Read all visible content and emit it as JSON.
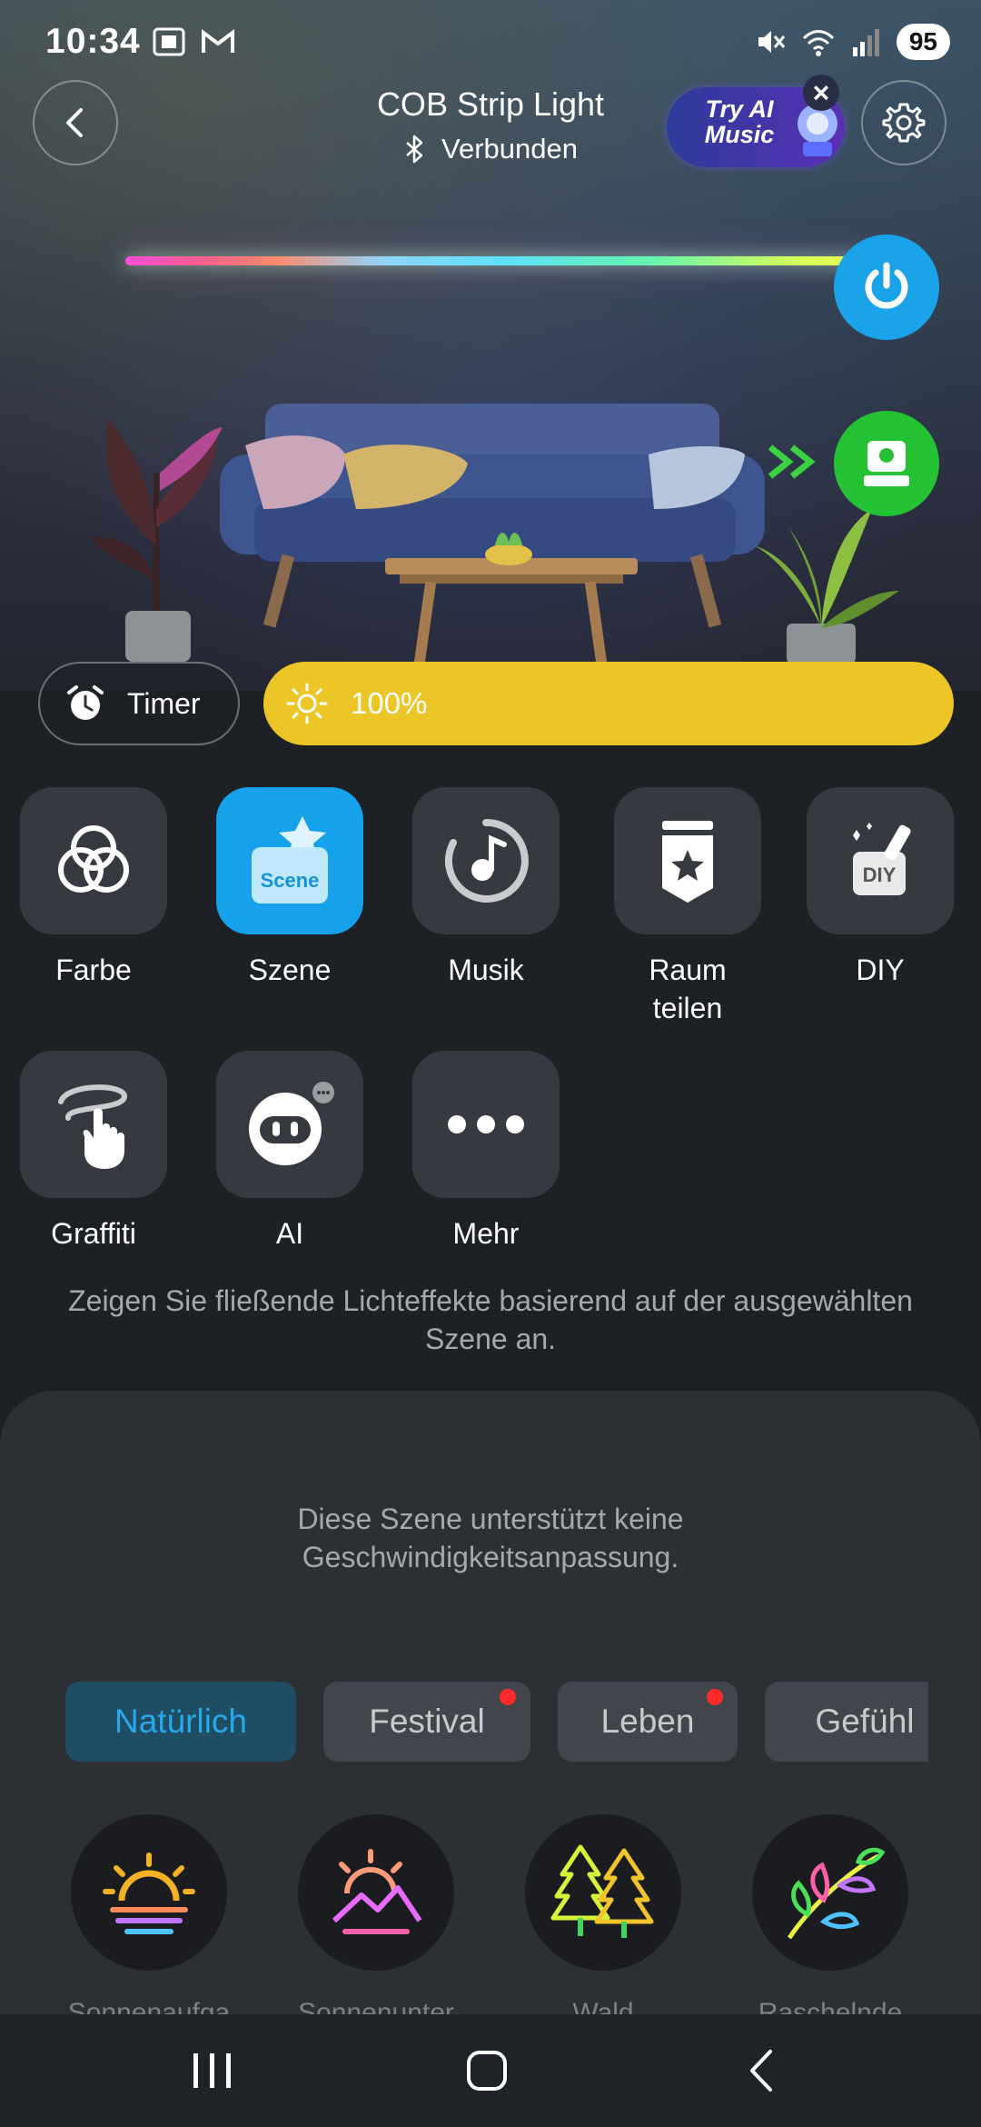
{
  "status_bar": {
    "time": "10:34",
    "battery": "95",
    "icons": [
      "screenshot-icon",
      "gmail-icon",
      "mute-icon",
      "wifi-icon",
      "signal-icon"
    ]
  },
  "header": {
    "title": "COB Strip Light",
    "connection_status": "Verbunden",
    "ai_banner_text": "Try AI Music"
  },
  "controls": {
    "timer_label": "Timer",
    "brightness_value": "100%",
    "brightness_level": 1.0
  },
  "functions": [
    {
      "label": "Farbe",
      "icon": "color-circles-icon",
      "active": false
    },
    {
      "label": "Szene",
      "icon": "scene-icon",
      "tile_text": "Scene",
      "active": true
    },
    {
      "label": "Musik",
      "icon": "music-icon",
      "active": false
    },
    {
      "label": "Raum\nteilen",
      "icon": "share-room-icon",
      "active": false
    },
    {
      "label": "DIY",
      "icon": "diy-icon",
      "tile_text": "DIY",
      "active": false
    },
    {
      "label": "Graffiti",
      "icon": "graffiti-icon",
      "active": false
    },
    {
      "label": "AI",
      "icon": "ai-robot-icon",
      "active": false
    },
    {
      "label": "Mehr",
      "icon": "more-icon",
      "active": false
    }
  ],
  "description": "Zeigen Sie fließende Lichteffekte basierend auf der ausgewählten Szene an.",
  "sheet": {
    "speed_note": "Diese Szene unterstützt keine Geschwindigkeitsanpassung.",
    "categories": [
      {
        "label": "Natürlich",
        "active": true,
        "dot": false
      },
      {
        "label": "Festival",
        "active": false,
        "dot": true
      },
      {
        "label": "Leben",
        "active": false,
        "dot": true
      },
      {
        "label": "Gefühl",
        "active": false,
        "dot": true
      }
    ],
    "scenes": [
      {
        "label": "Sonnenaufga",
        "icon": "sunrise-icon"
      },
      {
        "label": "Sonnenunter",
        "icon": "sunset-icon"
      },
      {
        "label": "Wald",
        "icon": "forest-icon"
      },
      {
        "label": "Raschelnde",
        "icon": "leaves-icon"
      }
    ]
  },
  "colors": {
    "accent_blue": "#16a2ea",
    "brightness_yellow": "#ecc526",
    "power_blue": "#1aa3e8",
    "device_green": "#24c234",
    "badge_red": "#ff2a2a"
  }
}
